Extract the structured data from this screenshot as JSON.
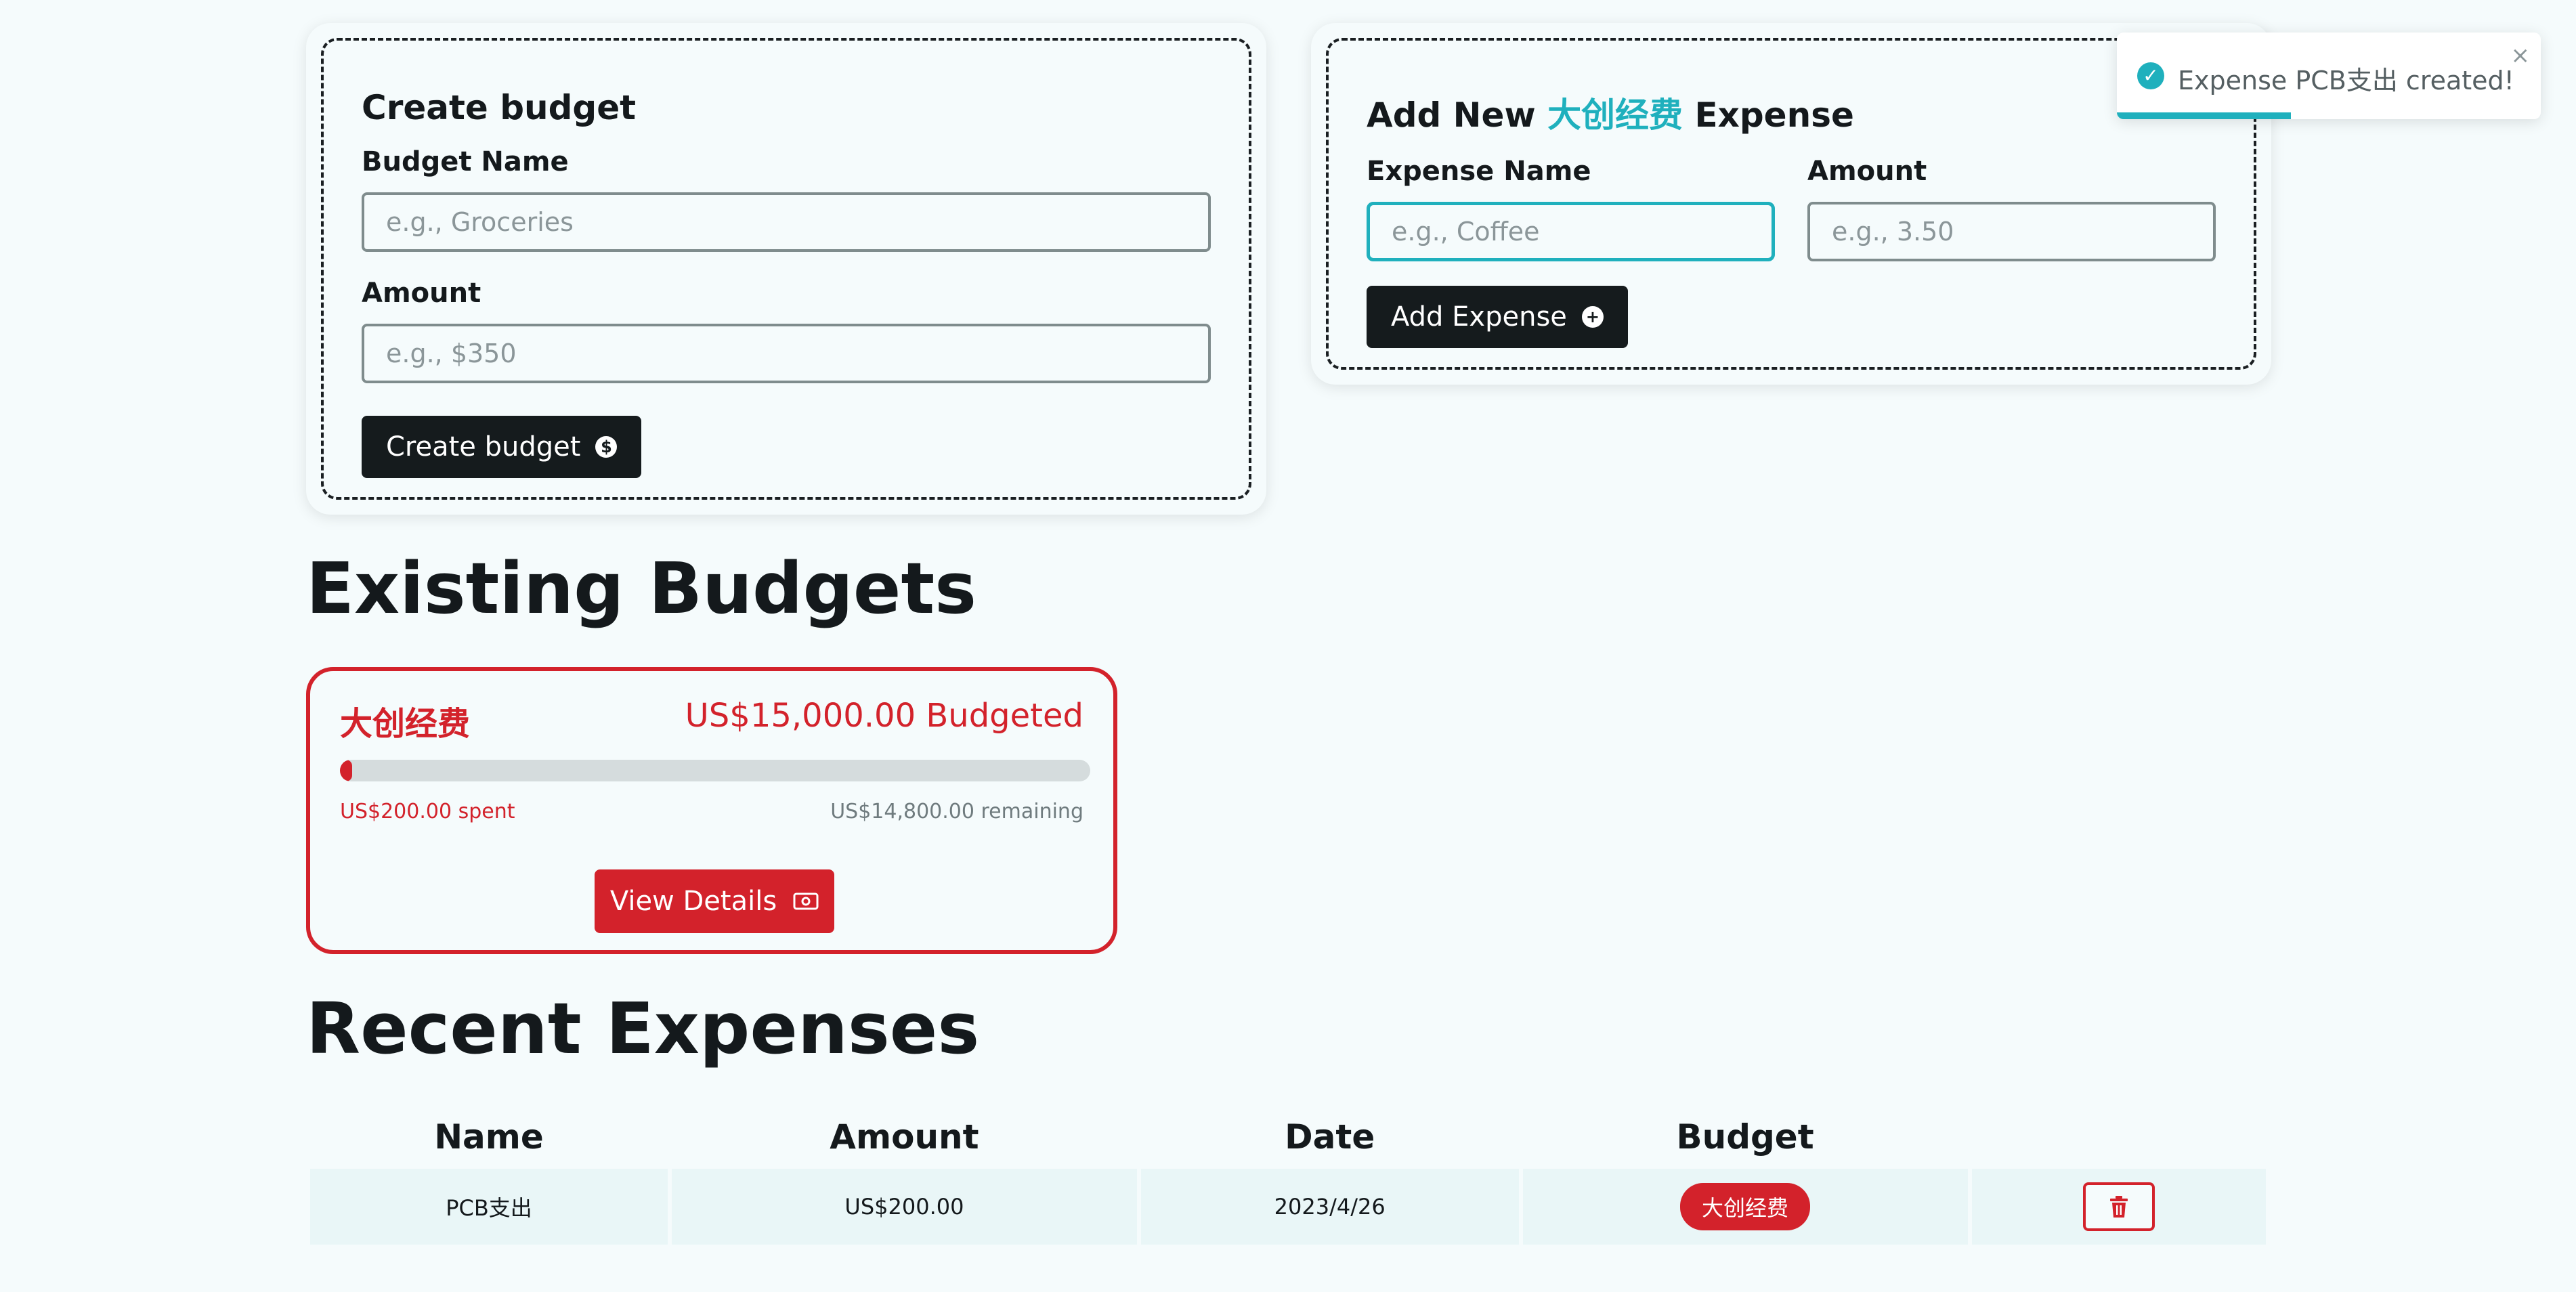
{
  "create_budget": {
    "title": "Create budget",
    "name_label": "Budget Name",
    "name_placeholder": "e.g., Groceries",
    "amount_label": "Amount",
    "amount_placeholder": "e.g., $350",
    "submit_label": "Create budget",
    "submit_icon": "dollar-circle-icon"
  },
  "add_expense": {
    "title_prefix": "Add New",
    "title_budget": "大创经费",
    "title_suffix": "Expense",
    "name_label": "Expense Name",
    "name_placeholder": "e.g., Coffee",
    "amount_label": "Amount",
    "amount_placeholder": "e.g., 3.50",
    "submit_label": "Add Expense",
    "submit_icon": "plus-circle-icon"
  },
  "toast": {
    "message": "Expense PCB支出 created!",
    "icon": "check-circle-icon",
    "progress": 0.41
  },
  "existing_budgets": {
    "heading": "Existing Budgets",
    "items": [
      {
        "name": "大创经费",
        "budgeted": "US$15,000.00 Budgeted",
        "spent": "US$200.00 spent",
        "remaining": "US$14,800.00 remaining",
        "progress": 0.0133,
        "button_label": "View Details",
        "button_icon": "banknote-icon",
        "color": "#d3222b"
      }
    ]
  },
  "recent_expenses": {
    "heading": "Recent Expenses",
    "columns": [
      "Name",
      "Amount",
      "Date",
      "Budget",
      ""
    ],
    "rows": [
      {
        "name": "PCB支出",
        "amount": "US$200.00",
        "date": "2023/4/26",
        "budget": "大创经费",
        "action_icon": "trash-icon"
      }
    ]
  },
  "colors": {
    "accent": "#1fb0bd",
    "budget_red": "#d3222b",
    "dark": "#151b1d",
    "background": "#f5fbfc"
  }
}
